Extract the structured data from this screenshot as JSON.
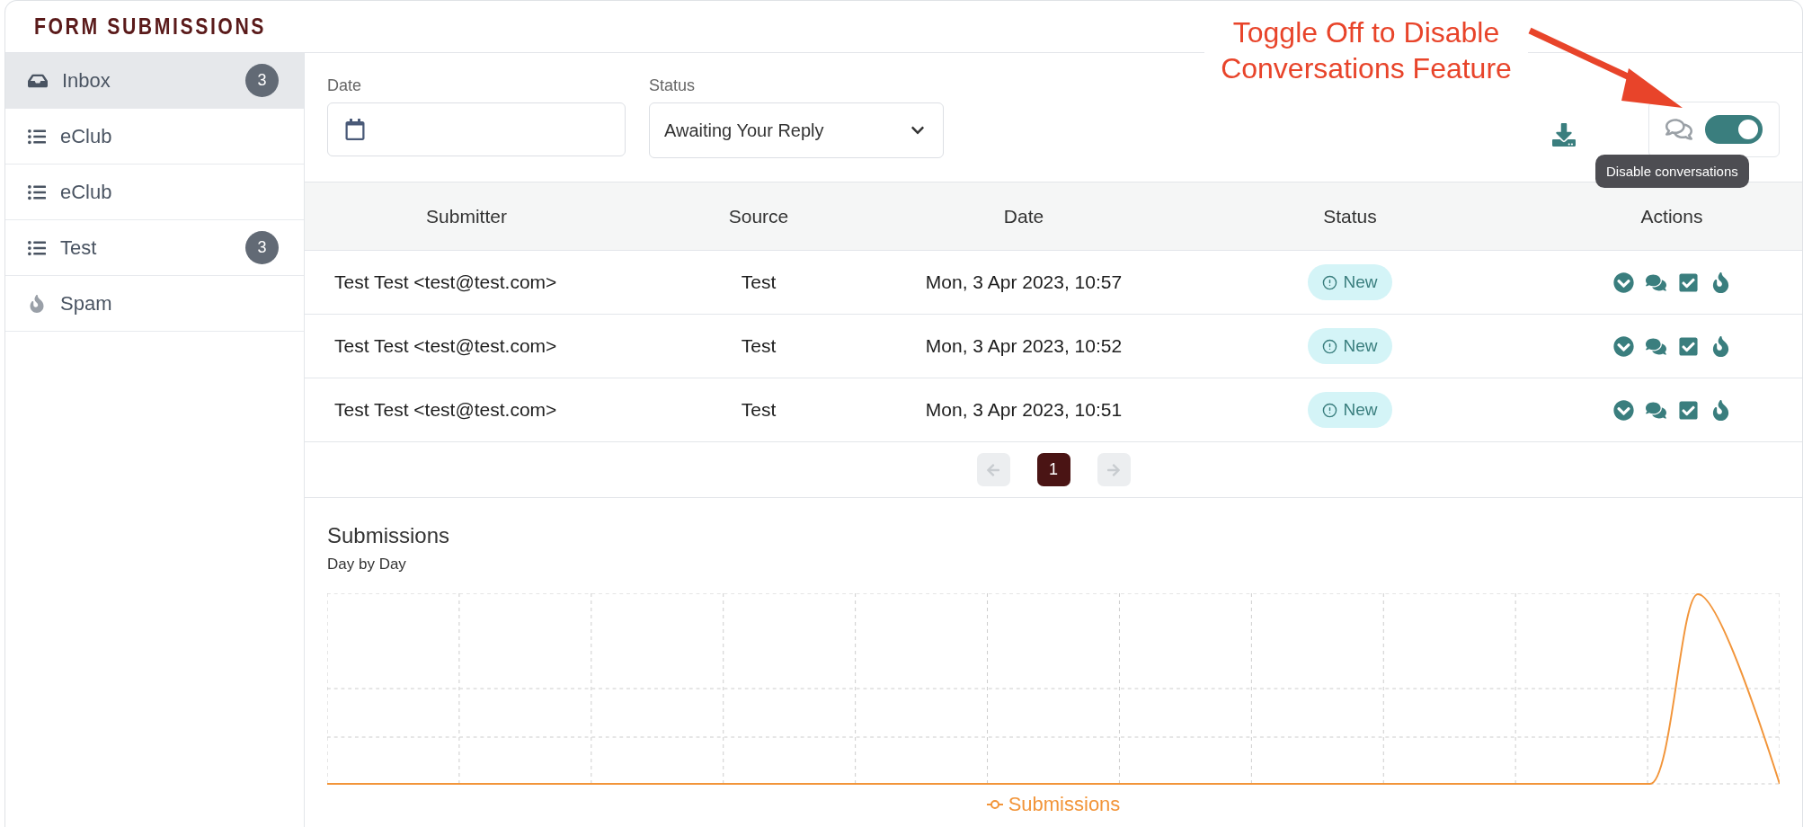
{
  "header": {
    "title": "FORM SUBMISSIONS"
  },
  "annotation": {
    "lines": [
      "Toggle Off to Disable",
      "Conversations Feature"
    ]
  },
  "sidebar": {
    "items": [
      {
        "label": "Inbox",
        "kind": "inbox",
        "badge": "3",
        "selected": true
      },
      {
        "label": "eClub",
        "kind": "list",
        "selected": false
      },
      {
        "label": "eClub",
        "kind": "list",
        "selected": false
      },
      {
        "label": "Test",
        "kind": "list",
        "badge": "3",
        "selected": false
      },
      {
        "label": "Spam",
        "kind": "spam",
        "selected": false
      }
    ]
  },
  "filters": {
    "date": {
      "label": "Date"
    },
    "status": {
      "label": "Status",
      "value": "Awaiting Your Reply"
    }
  },
  "conversations": {
    "on": true,
    "tooltip": "Disable conversations"
  },
  "table": {
    "columns": [
      "Submitter",
      "Source",
      "Date",
      "Status",
      "Actions"
    ],
    "rows": [
      {
        "submitter": "Test Test <test@test.com>",
        "source": "Test",
        "date": "Mon, 3 Apr 2023, 10:57",
        "status": "New"
      },
      {
        "submitter": "Test Test <test@test.com>",
        "source": "Test",
        "date": "Mon, 3 Apr 2023, 10:52",
        "status": "New"
      },
      {
        "submitter": "Test Test <test@test.com>",
        "source": "Test",
        "date": "Mon, 3 Apr 2023, 10:51",
        "status": "New"
      }
    ]
  },
  "pagination": {
    "pages": [
      {
        "label": "1",
        "selected": true
      }
    ]
  },
  "chart": {
    "title": "Submissions",
    "subtitle": "Day by Day",
    "legend": "Submissions"
  }
}
